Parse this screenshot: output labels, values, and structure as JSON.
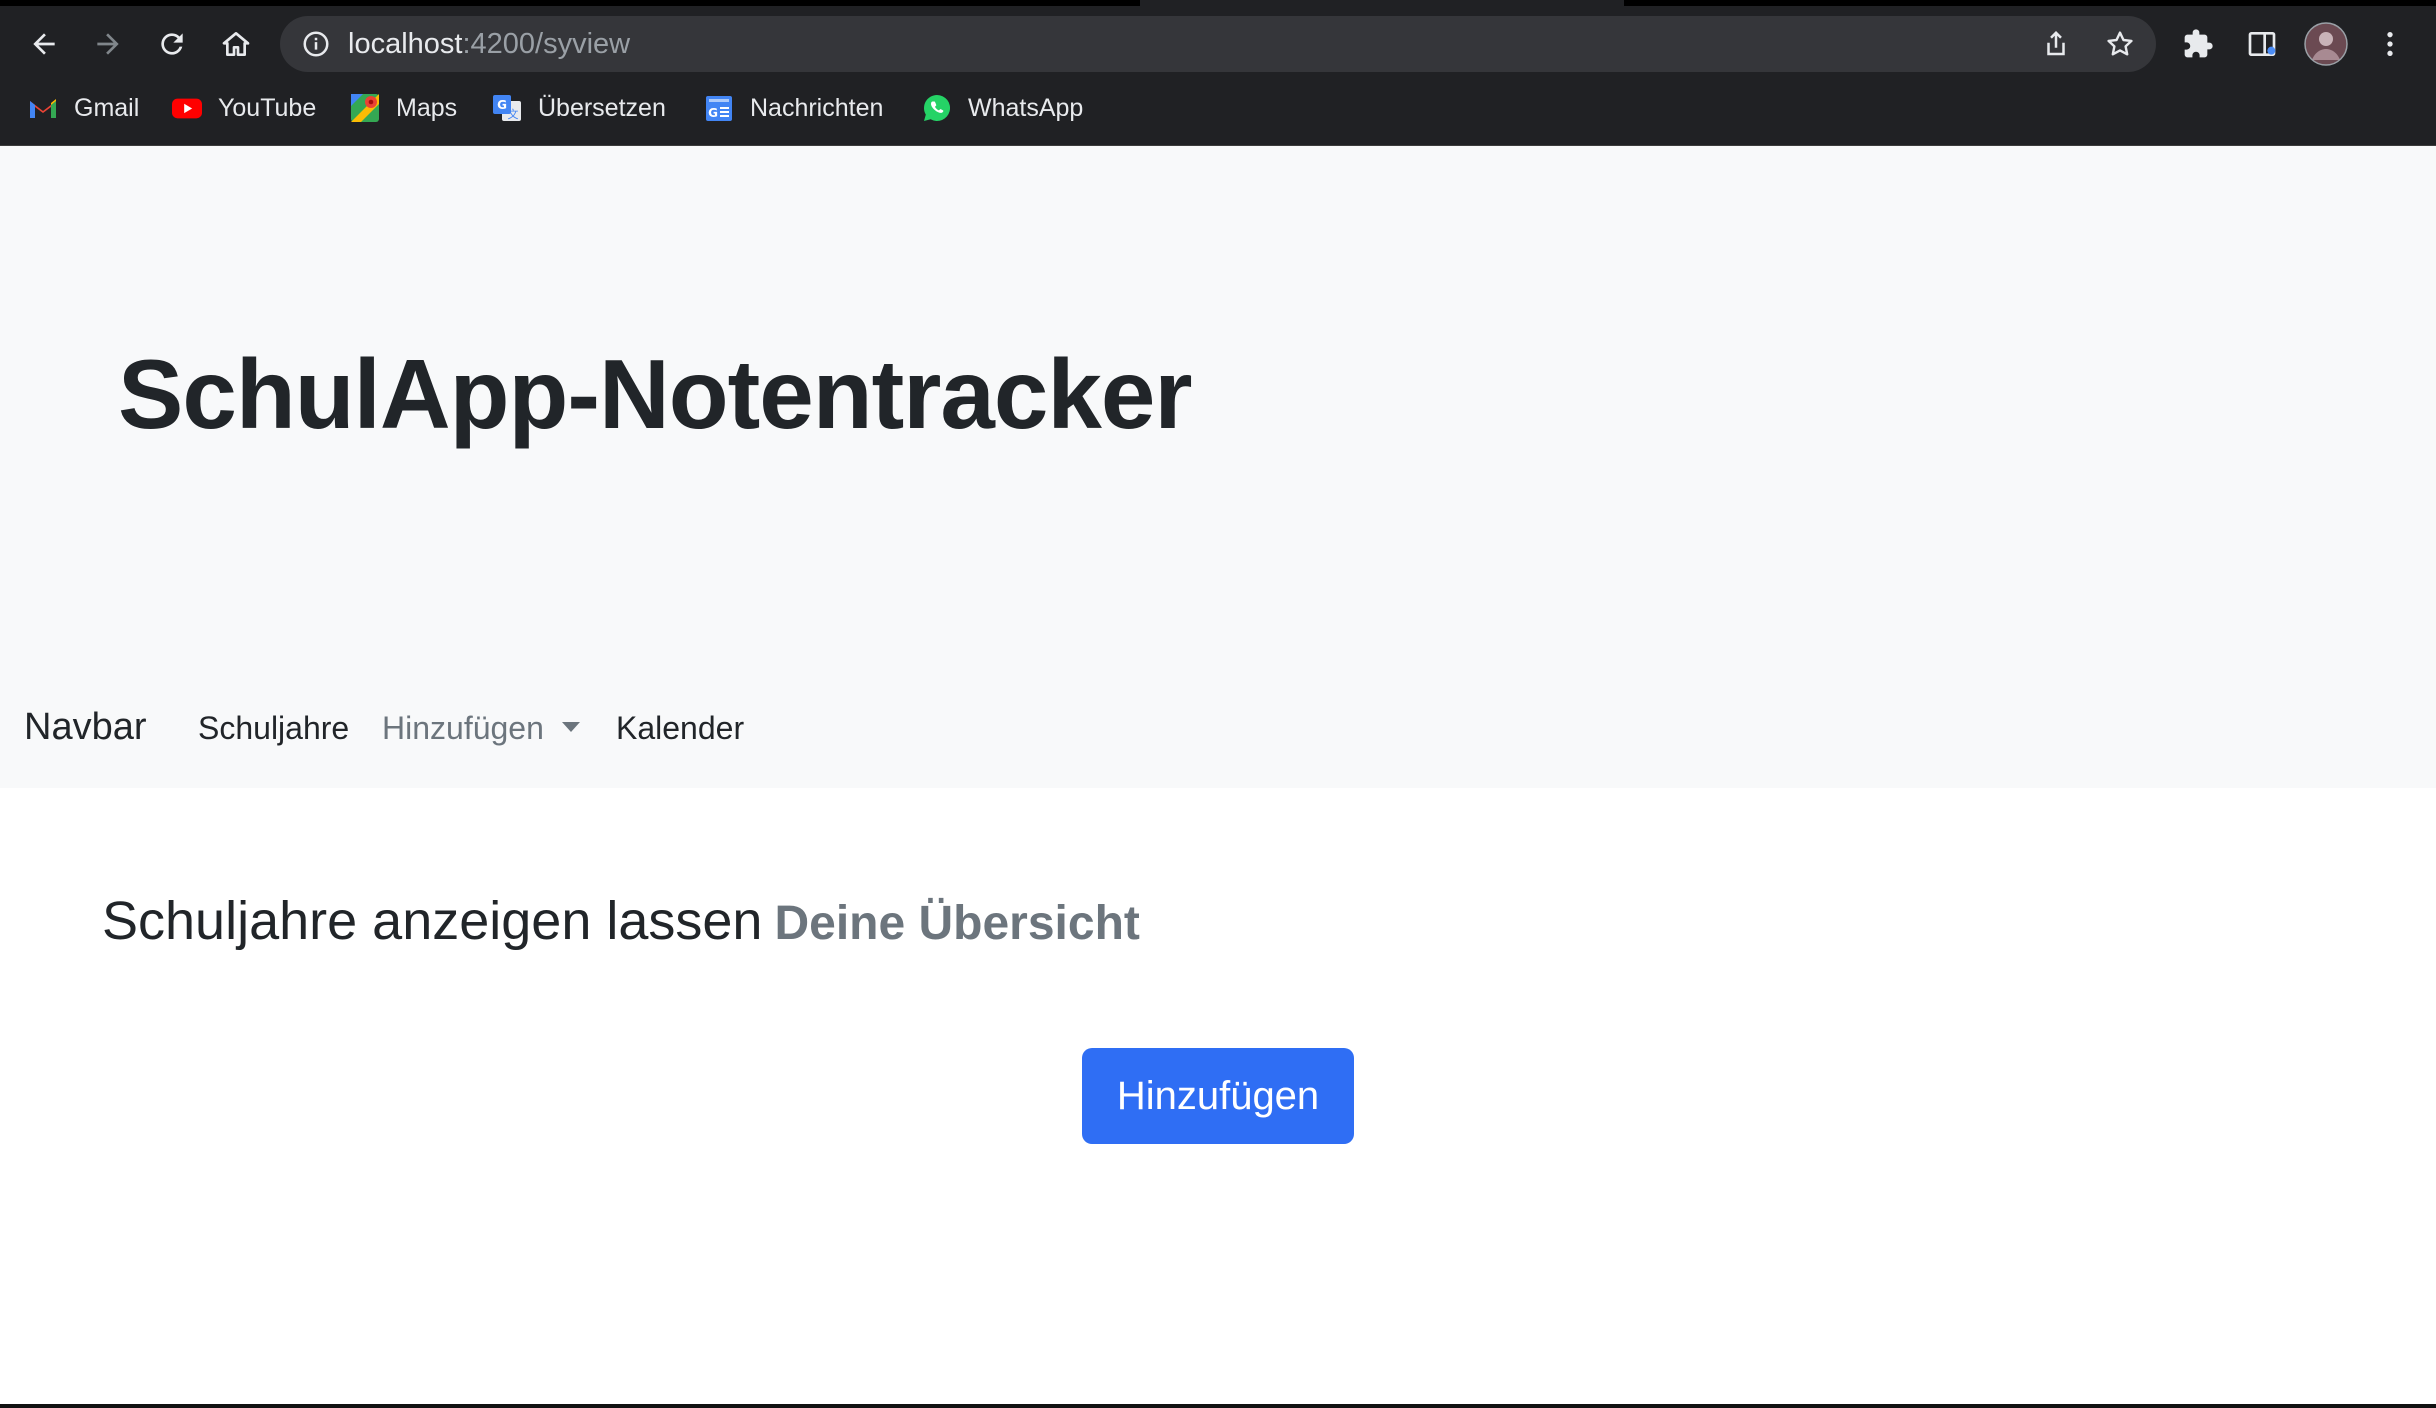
{
  "browser": {
    "url_host": "localhost",
    "url_rest": ":4200/syview",
    "bookmarks": [
      {
        "label": "Gmail",
        "icon": "gmail-icon"
      },
      {
        "label": "YouTube",
        "icon": "youtube-icon"
      },
      {
        "label": "Maps",
        "icon": "maps-icon"
      },
      {
        "label": "Übersetzen",
        "icon": "translate-icon"
      },
      {
        "label": "Nachrichten",
        "icon": "news-icon"
      },
      {
        "label": "WhatsApp",
        "icon": "whatsapp-icon"
      }
    ]
  },
  "header": {
    "title": "SchulApp-Notentracker"
  },
  "navbar": {
    "brand": "Navbar",
    "items": [
      {
        "label": "Schuljahre"
      },
      {
        "label": "Hinzufügen"
      },
      {
        "label": "Kalender"
      }
    ]
  },
  "main": {
    "heading": "Schuljahre anzeigen lassen",
    "subheading": "Deine Übersicht",
    "add_button": "Hinzufügen"
  },
  "colors": {
    "primary": "#2f6ef4",
    "jumbotron_bg": "#f8f9fa",
    "muted_text": "#6c757d"
  }
}
